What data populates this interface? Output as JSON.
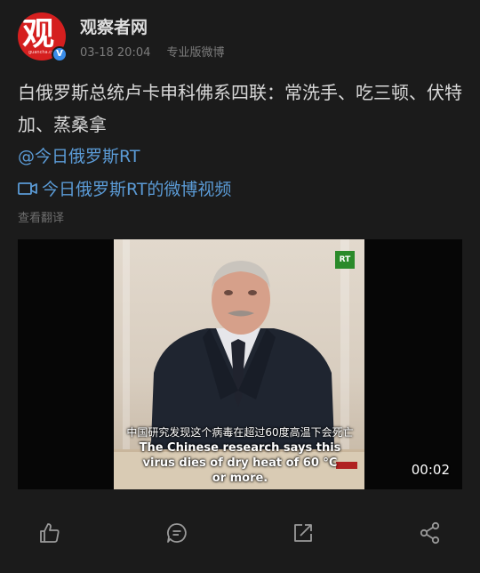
{
  "author": {
    "name": "观察者网",
    "avatar_glyph": "观",
    "avatar_url_text": "guancha.cn",
    "verified_mark": "V"
  },
  "meta": {
    "time": "03-18 20:04",
    "source": "专业版微博"
  },
  "post": {
    "text": "白俄罗斯总统卢卡申科佛系四联：常洗手、吃三顿、伏特加、蒸桑拿",
    "mention": "@今日俄罗斯RT",
    "video_link": "今日俄罗斯RT的微博视频",
    "translate": "查看翻译"
  },
  "video": {
    "logo": "RT",
    "subtitle_zh": "中国研究发现这个病毒在超过60度高温下会死亡",
    "subtitle_en_1": "The Chinese research says this",
    "subtitle_en_2": "virus dies of dry heat of 60 °C",
    "subtitle_en_3": "or more.",
    "duration": "00:02"
  },
  "actions": [
    {
      "icon": "thumbs-up-icon"
    },
    {
      "icon": "comment-icon"
    },
    {
      "icon": "repost-icon"
    },
    {
      "icon": "share-icon"
    }
  ],
  "colors": {
    "background": "#1b1b1b",
    "link": "#5b9bd6",
    "brand_red": "#d51f1f",
    "verified_blue": "#3a8ce8"
  }
}
